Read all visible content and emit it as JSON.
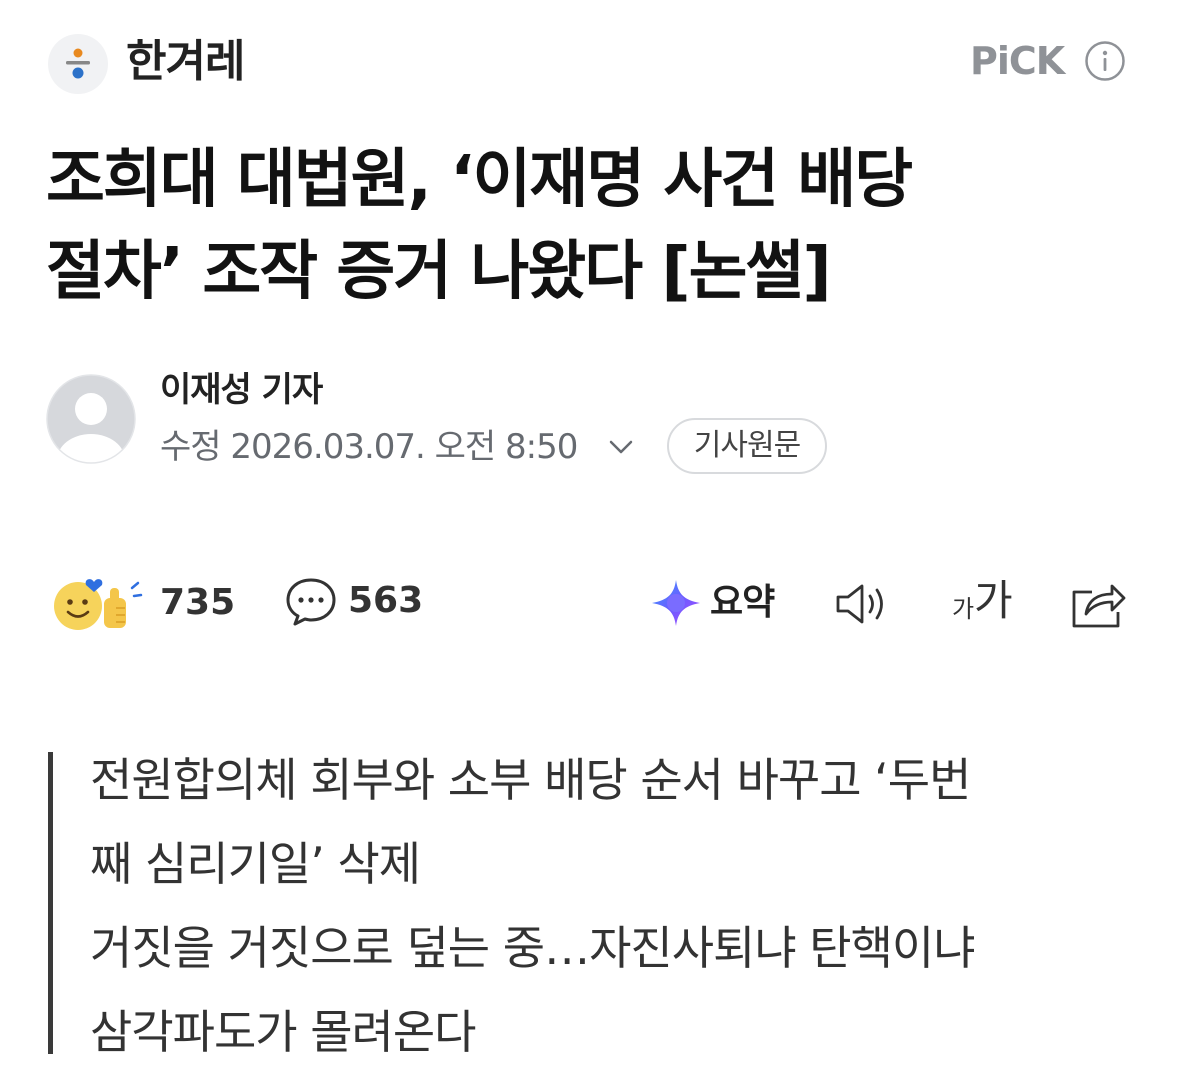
{
  "header": {
    "press_name": "한겨레",
    "pick_label": "PiCK",
    "press_logo_icon": "hankyoreh-logo-icon",
    "info_icon": "info-icon",
    "logo_colors": {
      "top": "#e8891f",
      "bar": "#888888",
      "bottom": "#2c72c9"
    }
  },
  "article": {
    "headline_lines": [
      "조희대 대법원, ‘이재명 사건 배당",
      "절차’ 조작 증거 나왔다 [논썰]"
    ],
    "byline": {
      "reporter": "이재성 기자",
      "dateline": "수정 2026.03.07. 오전 8:50",
      "original_button": "기사원문"
    },
    "subhead_lines": [
      "전원합의체 회부와 소부 배당 순서 바꾸고 ‘두번",
      "째 심리기일’ 삭제",
      "거짓을 거짓으로 덮는 중…자진사퇴냐 탄핵이냐",
      "삼각파도가 몰려온다"
    ]
  },
  "actions": {
    "reactions_count": "735",
    "comments_count": "563",
    "summary_label": "요약",
    "font_small": "가",
    "font_large": "가",
    "icons": [
      "reaction-emoji-icon",
      "comment-icon",
      "ai-summary-icon",
      "speaker-icon",
      "font-size-icon",
      "share-icon"
    ]
  }
}
